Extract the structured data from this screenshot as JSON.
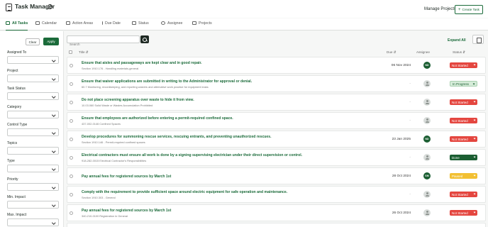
{
  "app": {
    "title": "Task Manager"
  },
  "header": {
    "manage_projects": "Manage Projects",
    "create_task": "Create Task"
  },
  "tabs": [
    {
      "label": "All Tasks",
      "icon": "list-icon",
      "active": true
    },
    {
      "label": "Calendar",
      "icon": "calendar-icon"
    },
    {
      "label": "Action Areas",
      "icon": "clipboard-icon"
    },
    {
      "label": "Due Date",
      "icon": "sort-icon"
    },
    {
      "label": "Status",
      "icon": "bar-chart-icon"
    },
    {
      "label": "Assignee",
      "icon": "users-icon"
    },
    {
      "label": "Projects",
      "icon": "briefcase-icon"
    }
  ],
  "sidebar": {
    "clear": "Clear",
    "apply": "Apply",
    "filters": [
      {
        "label": "Assigned To"
      },
      {
        "label": "Project"
      },
      {
        "label": "Task Status"
      },
      {
        "label": "Category"
      },
      {
        "label": "Control Type"
      },
      {
        "label": "Topics"
      },
      {
        "label": "Type"
      },
      {
        "label": "Priority"
      },
      {
        "label": "Min. Impact"
      },
      {
        "label": "Max. Impact"
      }
    ]
  },
  "toolbar": {
    "search_placeholder": "Search",
    "expand_all": "Expand All"
  },
  "table": {
    "columns": {
      "title": "Title",
      "due": "Due",
      "assignee": "Assignee",
      "status": "Status"
    },
    "rows": [
      {
        "title": "Ensure that aisles and passageways are kept clear and in good repair.",
        "subtitle": "Section 1910.176 - Handling materials-general",
        "due": "06 Nov 2024",
        "assignee": "ND",
        "status": "Not Started",
        "status_type": "not-started"
      },
      {
        "title": "Ensure that waiver applications are submitted in writing to the Administrator for approval or denial.",
        "subtitle": "60.7 Monitoring, recordkeeping, and reporting waivers and alternative work practice for equipment leaks",
        "due": "-",
        "assignee": "",
        "status": "In Progress",
        "status_type": "in-progress"
      },
      {
        "title": "Do not place screening apparatus over waste to hide it from view.",
        "subtitle": "10.03.060 Solid Waste or Wastes Accumulation Prohibited",
        "due": "-",
        "assignee": "",
        "status": "Not Started",
        "status_type": "not-started"
      },
      {
        "title": "Ensure that employees are authorized before entering a permit-required confined space.",
        "subtitle": "437-002-0146 Confined Spaces",
        "due": "-",
        "assignee": "",
        "status": "Not Started",
        "status_type": "not-started"
      },
      {
        "title": "Develop procedures for summoning rescue services, rescuing entrants, and preventing unauthorized rescues.",
        "subtitle": "Section 1910.146 - Permit-required confined spaces",
        "due": "23 Jan 2025",
        "assignee": "ND",
        "status": "Not Started",
        "status_type": "not-started"
      },
      {
        "title": "Electrical contractors must ensure all work is done by a signing supervising electrician under their direct supervision or control.",
        "subtitle": "918-282-0015 Electrical Contractor's Responsibilities",
        "due": "-",
        "assignee": "",
        "status": "Done",
        "status_type": "done"
      },
      {
        "title": "Pay annual fees for registered sources by March 1st",
        "subtitle": "",
        "due": "28 Oct 2024",
        "assignee": "SM",
        "status": "Paused",
        "status_type": "paused"
      },
      {
        "title": "Comply with the requirement to provide sufficient space around electric equipment for safe operation and maintenance.",
        "subtitle": "Section 1910.303 - General",
        "due": "-",
        "assignee": "",
        "status": "Not Started",
        "status_type": "not-started"
      },
      {
        "title": "Pay annual fees for registered sources by March 1st",
        "subtitle": "340-210-0100 Registration in General",
        "due": "26 Oct 2024",
        "assignee": "",
        "status": "Not Started",
        "status_type": "not-started"
      }
    ]
  },
  "colors": {
    "brand": "#1b6b3a",
    "not_started": "#e4463f",
    "done": "#1b5e32",
    "paused": "#f2c033",
    "in_progress": "#d6ecd9"
  }
}
